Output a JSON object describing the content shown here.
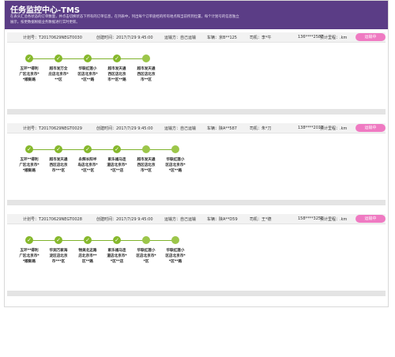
{
  "header": {
    "title": "任务监控中心-TMS",
    "desc": "在表头汇总各状态的订单数量，并点击切换状态下所有的订单信息，在列表中，列出每个订单途经的所有地点和当前所到位置，每个计划号的信息独立展示，按更数据根据业务数据进行实时更新。"
  },
  "field_labels": {
    "plan": "计划号：",
    "created": "创建时间：",
    "carrier": "运输方：",
    "vehicle": "车辆：",
    "driver": "司机：",
    "mileage": "预计里程："
  },
  "cards": [
    {
      "plan_no": "T20170629NEGT0030",
      "created_at": "2017/7/29 9:45:00",
      "carrier": "自己运输",
      "vehicle": "京B**125",
      "driver": "李*牛",
      "phone": "136****2587",
      "mileage": ".km",
      "button": "运输中",
      "stops": [
        {
          "label": "五环**得利广区北京市**顺新路",
          "done": true
        },
        {
          "label": "超市发万全庄店北京市***区",
          "done": true
        },
        {
          "label": "华联红莲小区店北京市**区**路",
          "done": true
        },
        {
          "label": "超市发天通西区店北京市**区**路",
          "done": true
        },
        {
          "label": "超市发天通西区店北京市**区",
          "done": false
        }
      ]
    },
    {
      "plan_no": "T20170629NEGT0029",
      "created_at": "2017/7/29 9:45:00",
      "carrier": "自己运输",
      "vehicle": "陕A**587",
      "driver": "朱*刀",
      "phone": "138****2013",
      "mileage": ".km",
      "button": "运输中",
      "stops": [
        {
          "label": "五环**得利广区北京市**顺新路",
          "done": true
        },
        {
          "label": "超市发天通西区店北京市***区",
          "done": true
        },
        {
          "label": "永辉长阳半岛店北京市**区**区",
          "done": true
        },
        {
          "label": "家乐福马连道店北京市**区**店",
          "done": true
        },
        {
          "label": "超市发天通西区店北京市**区",
          "done": false
        },
        {
          "label": "华联红莲小区店北京市**区**路",
          "done": false
        }
      ]
    },
    {
      "plan_no": "T20170629NEGT0028",
      "created_at": "2017/7/29 9:45:00",
      "carrier": "自己运输",
      "vehicle": "陕A**D59",
      "driver": "王*德",
      "phone": "158****3251",
      "mileage": ".km",
      "button": "运输中",
      "stops": [
        {
          "label": "五环**得利广区北京市**顺新路",
          "done": true
        },
        {
          "label": "华润万家海淀区店北京市***区",
          "done": true
        },
        {
          "label": "物美北这路店北京市**区**路",
          "done": true
        },
        {
          "label": "家乐福马连道店北京市**区**店",
          "done": true
        },
        {
          "label": "华联红莲小区店北京市**区",
          "done": false
        },
        {
          "label": "华联红莲小区店北京市**区**路",
          "done": false
        }
      ]
    }
  ],
  "colors": {
    "header": "#5b3d86",
    "accent": "#ef7ac2",
    "done": "#86b82c"
  },
  "icons": {
    "done": "checkmark-icon",
    "pending": "circle-icon"
  }
}
